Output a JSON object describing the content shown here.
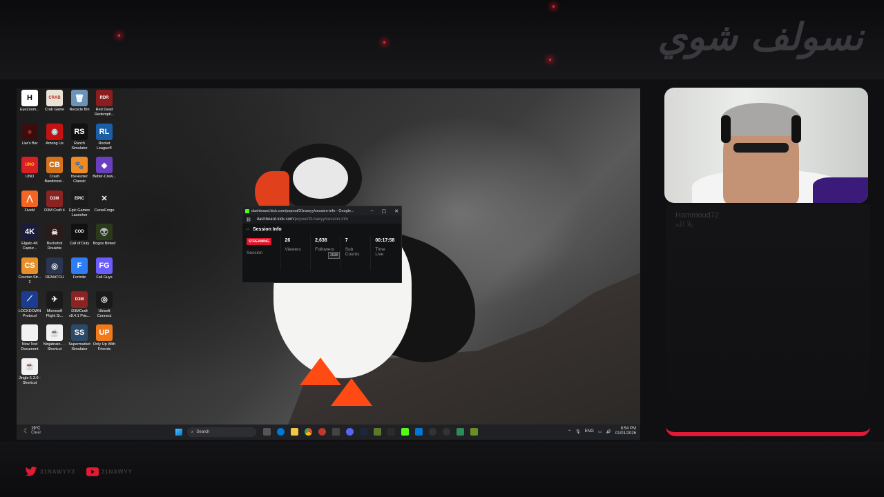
{
  "overlay": {
    "title": "نسولف شوي",
    "accent_color": "#e31a35",
    "socials": [
      {
        "icon": "twitter-icon",
        "handle": "31NAWYY3"
      },
      {
        "icon": "youtube-icon",
        "handle": "31NAWYY"
      }
    ],
    "chat_username": "Hammoud72",
    "chat_message": "يلا لله"
  },
  "desktop": {
    "icons": [
      {
        "label": "EyeZoom...",
        "color": "#ffffff",
        "glyph": "H",
        "fg": "#000"
      },
      {
        "label": "Crab Game",
        "color": "#e9e3d6",
        "glyph": "CRAB",
        "fg": "#b6312b"
      },
      {
        "label": "Recycle Bin",
        "color": "#6b93b8",
        "glyph": "🗑",
        "fg": "#fff"
      },
      {
        "label": "Red Dead Redempti...",
        "color": "#8c1d1d",
        "glyph": "RDR",
        "fg": "#fff"
      },
      {
        "label": "Liar's Bar",
        "color": "#3a0e0e",
        "glyph": "♠",
        "fg": "#c22"
      },
      {
        "label": "Among Us",
        "color": "#c51111",
        "glyph": "◉",
        "fg": "#aee"
      },
      {
        "label": "Ranch Simulator",
        "color": "#111",
        "glyph": "RS",
        "fg": "#fff"
      },
      {
        "label": "Rocket League®",
        "color": "#1a5ea8",
        "glyph": "RL",
        "fg": "#fff"
      },
      {
        "label": "UNO",
        "color": "#d81f26",
        "glyph": "UNO",
        "fg": "#ffd400"
      },
      {
        "label": "Crash Bandicoot...",
        "color": "#d4721b",
        "glyph": "CB",
        "fg": "#fff"
      },
      {
        "label": "theHunter Classic",
        "color": "#f08a24",
        "glyph": "🐾",
        "fg": "#fff"
      },
      {
        "label": "Better-Crew...",
        "color": "#6a3fbf",
        "glyph": "◆",
        "fg": "#fff"
      },
      {
        "label": "FiveM",
        "color": "#f26522",
        "glyph": "⋀",
        "fg": "#fff"
      },
      {
        "label": "D3M Craft 4",
        "color": "#8b2323",
        "glyph": "D3M",
        "fg": "#fff"
      },
      {
        "label": "Epic Games Launcher",
        "color": "#1b1b1b",
        "glyph": "EPIC",
        "fg": "#fff"
      },
      {
        "label": "CurseForge",
        "color": "#1f1f1f",
        "glyph": "✕",
        "fg": "#fff"
      },
      {
        "label": "Elgato 4K Captur...",
        "color": "#1b1b3a",
        "glyph": "4K",
        "fg": "#fff"
      },
      {
        "label": "Buckshot Roulette",
        "color": "#2a1a1a",
        "glyph": "☠",
        "fg": "#eee"
      },
      {
        "label": "Call of Duty",
        "color": "#111",
        "glyph": "COD",
        "fg": "#fff"
      },
      {
        "label": "Bogos Binted",
        "color": "#2b3a1a",
        "glyph": "👽",
        "fg": "#7f7"
      },
      {
        "label": "Counter-Str... 2",
        "color": "#e7902b",
        "glyph": "CS",
        "fg": "#fff"
      },
      {
        "label": "REMATCH",
        "color": "#2a3550",
        "glyph": "◎",
        "fg": "#fff"
      },
      {
        "label": "Fortnite",
        "color": "#2f7df6",
        "glyph": "F",
        "fg": "#fff"
      },
      {
        "label": "Fall Guys",
        "color": "#6a5cff",
        "glyph": "FG",
        "fg": "#fff"
      },
      {
        "label": "LOCKDOWN Protocol",
        "color": "#1c3d8f",
        "glyph": "⟋",
        "fg": "#fff"
      },
      {
        "label": "Microsoft Flight Si...",
        "color": "#1a1a1a",
        "glyph": "✈",
        "fg": "#fff"
      },
      {
        "label": "D3MCraft v8.4.1 Pris...",
        "color": "#8b2323",
        "glyph": "D3M",
        "fg": "#fff"
      },
      {
        "label": "Ubisoft Connect",
        "color": "#1a1a1a",
        "glyph": "◎",
        "fg": "#fff"
      },
      {
        "label": "New Text Document",
        "color": "#f2f2f2",
        "glyph": "",
        "fg": "#000"
      },
      {
        "label": "Ninjabrain... - Shortcut",
        "color": "#f2f2f2",
        "glyph": "☕",
        "fg": "#c33"
      },
      {
        "label": "Supermarket Simulator",
        "color": "#2a4a6a",
        "glyph": "SS",
        "fg": "#fff"
      },
      {
        "label": "Only Up With Friends",
        "color": "#f07a1a",
        "glyph": "UP",
        "fg": "#fff"
      },
      {
        "label": "Jingle-1.3.0 - Shortcut",
        "color": "#f2f2f2",
        "glyph": "☕",
        "fg": "#c33"
      }
    ]
  },
  "taskbar": {
    "weather_temp": "19°C",
    "weather_desc": "Clear",
    "search_placeholder": "Search",
    "lang": "ENG",
    "time": "8:54 PM",
    "date": "01/01/2026"
  },
  "popout": {
    "window_title": "dashboard.kick.com/popout/31nawyy/session-info - Google...",
    "url_host": "dashboard.kick.com",
    "url_path": "/popout/31nawyy/session-info",
    "heading": "Session Info",
    "badge": "STREAMING",
    "session_label": "Session",
    "viewers_value": "26",
    "viewers_label": "Viewers",
    "followers_value": "2,638",
    "followers_label": "Followers",
    "followers_tooltip": "2638",
    "subs_value": "7",
    "subs_label1": "Sub",
    "subs_label2": "Counts",
    "time_value": "00:17:58",
    "time_label1": "Time",
    "time_label2": "Live"
  }
}
